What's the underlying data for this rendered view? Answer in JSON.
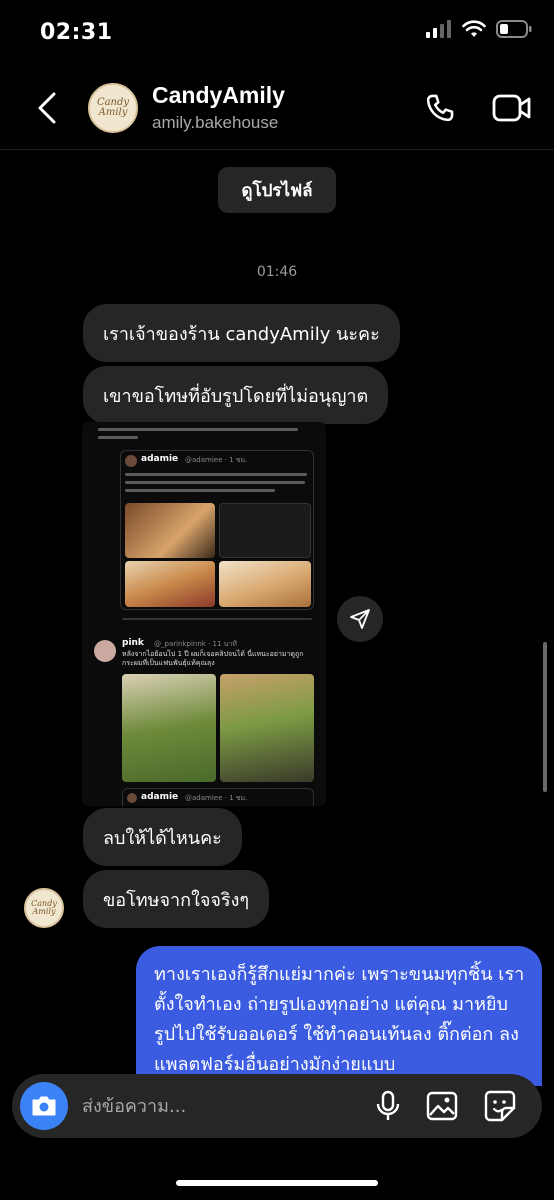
{
  "status_bar": {
    "time": "02:31"
  },
  "header": {
    "avatar_text": "Candy Amily",
    "name": "CandyAmily",
    "username": "amily.bakehouse"
  },
  "profile_button": {
    "label": "ดูโปรไฟล์"
  },
  "chat": {
    "timestamp": "01:46",
    "messages_in": [
      "เราเจ้าของร้าน candyAmily นะคะ",
      "เขาขอโทษที่อับรูปโดยที่ไม่อนุญาต",
      "ลบให้ได้ไหนคะ",
      "ขอโทษจากใจจริงๆ"
    ],
    "message_out": "ทางเราเองก็รู้สึกแย่มากค่ะ เพราะขนมทุกชิ้น เราตั้งใจทำเอง ถ่ายรูปเองทุกอย่าง แต่คุณ มาหยิบรูปไปใช้รับออเดอร์ ใช้ทำคอนเท้นลง ติ๊กต่อก ลงแพลตฟอร์มอื่นอย่างมักง่ายแบบ"
  },
  "shared_image": {
    "tweet1_author": "adamie",
    "tweet1_handle": "@adamiee · 1 ชม.",
    "tweet2_author": "pink",
    "tweet2_handle": "@_parinkpinnk · 11 นาที",
    "tweet2_text": "หลังจากไอย้อนไป 1 ปี ผมก็เจอคลิปจนได้ นี่แหนะอย่ามาดูถูก กระผมที่เป็นแฟนพันธุ์แท้คุณลุง",
    "quoted_author": "adamie",
    "quoted_handle": "@adamiee · 1 ชม."
  },
  "composer": {
    "placeholder": "ส่งข้อความ..."
  },
  "colors": {
    "background": "#000000",
    "bubble_in": "#262626",
    "bubble_out": "#3b5ce0",
    "camera_button": "#3b82f6"
  }
}
